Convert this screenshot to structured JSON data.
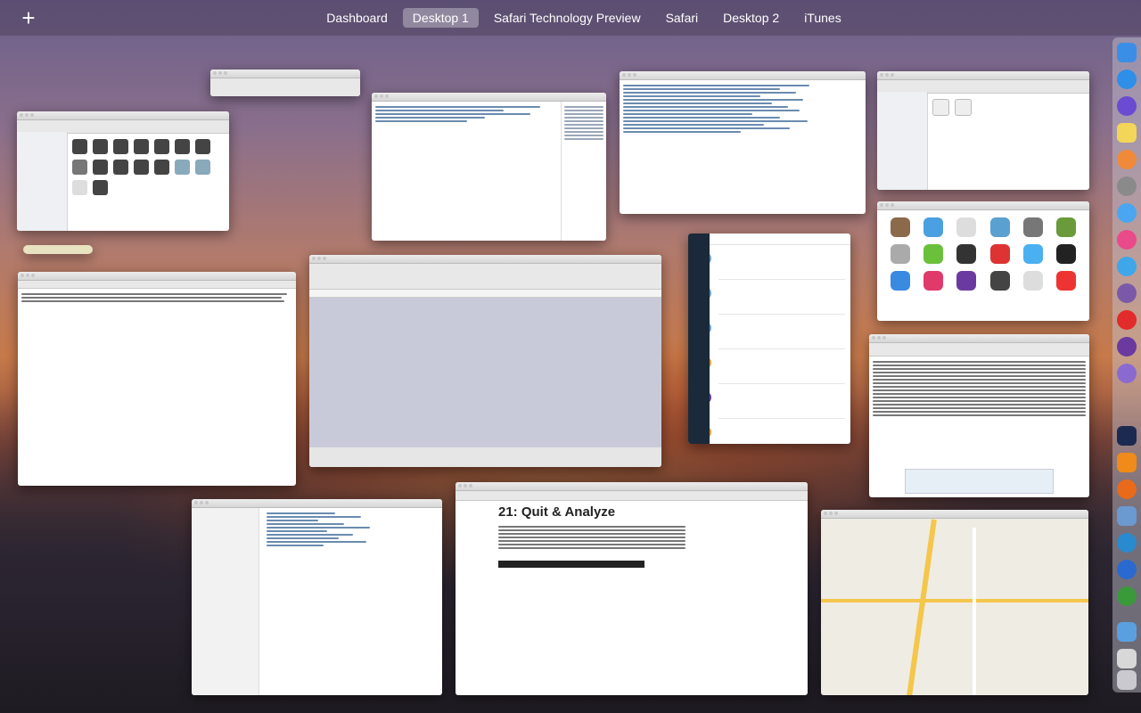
{
  "spaces_bar": {
    "add_label": "+",
    "spaces": [
      {
        "label": "Dashboard",
        "active": false
      },
      {
        "label": "Desktop 1",
        "active": true
      },
      {
        "label": "Safari Technology Preview",
        "active": false
      },
      {
        "label": "Safari",
        "active": false
      },
      {
        "label": "Desktop 2",
        "active": false
      },
      {
        "label": "iTunes",
        "active": false
      }
    ]
  },
  "windows": {
    "article": {
      "title": "21: Quit & Analyze"
    }
  },
  "dock": {
    "items": [
      {
        "icon": "finder-icon",
        "color": "#3a8ee6"
      },
      {
        "icon": "safari-icon",
        "color": "#2f8ee8"
      },
      {
        "icon": "siri-icon",
        "color": "#6a4bd1"
      },
      {
        "icon": "notes-icon",
        "color": "#f3d55a"
      },
      {
        "icon": "photos-icon",
        "color": "#f08a3a"
      },
      {
        "icon": "system-preferences-icon",
        "color": "#8a8a8a"
      },
      {
        "icon": "messages-icon",
        "color": "#4aa6f0"
      },
      {
        "icon": "itunes-icon",
        "color": "#e94a8a"
      },
      {
        "icon": "twitter-icon",
        "color": "#3fa6ea"
      },
      {
        "icon": "app-blocker-icon",
        "color": "#7a5aa8"
      },
      {
        "icon": "opera-icon",
        "color": "#e22b2b"
      },
      {
        "icon": "podcast-icon",
        "color": "#6a3aa0"
      },
      {
        "icon": "clock-icon",
        "color": "#8a6ad0"
      },
      {
        "icon": "photoshop-icon",
        "color": "#1c2a52"
      },
      {
        "icon": "vlc-icon",
        "color": "#f08a1a"
      },
      {
        "icon": "firefox-icon",
        "color": "#e86a1a"
      },
      {
        "icon": "preview-icon",
        "color": "#6a9ad0"
      },
      {
        "icon": "network-icon",
        "color": "#2a8ad0"
      },
      {
        "icon": "fetch-icon",
        "color": "#2a6ad0"
      },
      {
        "icon": "leaf-icon",
        "color": "#3a9a3a"
      },
      {
        "icon": "folder-icon",
        "color": "#5aa0e0"
      },
      {
        "icon": "downloads-icon",
        "color": "#d8d8d8"
      },
      {
        "icon": "trash-icon",
        "color": "#c9c9cf"
      }
    ]
  }
}
